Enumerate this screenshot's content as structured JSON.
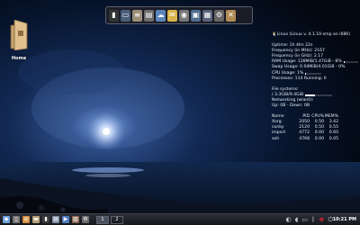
{
  "desktop": {
    "home_label": "Home"
  },
  "dock": {
    "icons": [
      {
        "name": "terminal-icon",
        "glyph": "▮",
        "color": "#333333"
      },
      {
        "name": "monitor-icon",
        "glyph": "▭",
        "color": "#4a5d7a"
      },
      {
        "name": "text-editor-icon",
        "glyph": "≡",
        "color": "#9c8f78"
      },
      {
        "name": "files-icon",
        "glyph": "▤",
        "color": "#6d6d6d"
      },
      {
        "name": "cloud-icon",
        "glyph": "☁",
        "color": "#5b85b8"
      },
      {
        "name": "email-icon",
        "glyph": "✉",
        "color": "#d9b44a"
      },
      {
        "name": "media-player-icon",
        "glyph": "◉",
        "color": "#777777"
      },
      {
        "name": "network-icon",
        "glyph": "▣",
        "color": "#4f6d90"
      },
      {
        "name": "screenshot-icon",
        "glyph": "▦",
        "color": "#59627a"
      },
      {
        "name": "settings-icon",
        "glyph": "⚙",
        "color": "#666666"
      },
      {
        "name": "tools-icon",
        "glyph": "✕",
        "color": "#b08c55"
      }
    ]
  },
  "conky": {
    "header": "Linux (Linux v. 4.1.10-smp on i686)",
    "uptime": "Uptime: 1h 4lm 22s",
    "freq_mhz": "Frequency (in MHz): 2167",
    "freq_ghz": "Frequency (in GHz): 2.17",
    "ram": "RAM Usage: 128MiB/1.47GiB - 8%",
    "ram_percent": 8,
    "swap": "Swap Usage: 0.04MiB/4.01GiB - 0%",
    "swap_percent": 0,
    "cpu": "CPU Usage: 1%",
    "cpu_percent": 1,
    "processes": "Processes: 114 Running: 0",
    "fs_title": "File systems:",
    "fs": "/ 3.3GiB/9.4GiB",
    "fs_percent": 35,
    "net_title": "Networking (wlan0):",
    "net": "Up: 0B  - Down: 0B",
    "proc_headers": [
      "Name",
      "PID",
      "CPU%",
      "MEM%"
    ],
    "procs": [
      [
        "Xorg",
        "2050",
        "0.50",
        "3.42"
      ],
      [
        "conky",
        "2120",
        "0.50",
        "0.55"
      ],
      [
        "import",
        "4772",
        "0.00",
        "0.60"
      ],
      [
        "ash",
        "4768",
        "0.00",
        "0.05"
      ]
    ]
  },
  "taskbar": {
    "start_icons": [
      {
        "name": "menu-icon",
        "glyph": "◆",
        "color": "#6ca0dc"
      },
      {
        "name": "trash-icon",
        "glyph": "▯",
        "color": "#777777"
      },
      {
        "name": "browser-icon",
        "glyph": "◍",
        "color": "#d68b3c"
      },
      {
        "name": "folder-icon",
        "glyph": "▬",
        "color": "#b8a47a"
      },
      {
        "name": "terminal-icon",
        "glyph": "▮",
        "color": "#3a3a3a"
      },
      {
        "name": "editor-icon",
        "glyph": "▤",
        "color": "#7f8ea6"
      },
      {
        "name": "player-icon",
        "glyph": "▶",
        "color": "#4f7ac2"
      },
      {
        "name": "image-icon",
        "glyph": "▨",
        "color": "#8d6b55"
      },
      {
        "name": "settings-icon",
        "glyph": "⚙",
        "color": "#6a6a6a"
      }
    ],
    "workspaces": [
      "1",
      "2"
    ],
    "tray_icons": [
      {
        "name": "network-tray-icon",
        "glyph": "◐",
        "color": "#c9c9c9"
      },
      {
        "name": "volume-icon",
        "glyph": "◖",
        "color": "#c9c9c9"
      },
      {
        "name": "battery-icon",
        "glyph": "▭",
        "color": "#c9c9c9"
      },
      {
        "name": "bluetooth-icon",
        "glyph": "ᛒ",
        "color": "#c9c9c9"
      },
      {
        "name": "slackware-icon",
        "glyph": "♚",
        "color": "#d2262e"
      },
      {
        "name": "exit-icon",
        "glyph": "⏻",
        "color": "#c9c9c9"
      }
    ],
    "clock": "10:21 PM"
  }
}
